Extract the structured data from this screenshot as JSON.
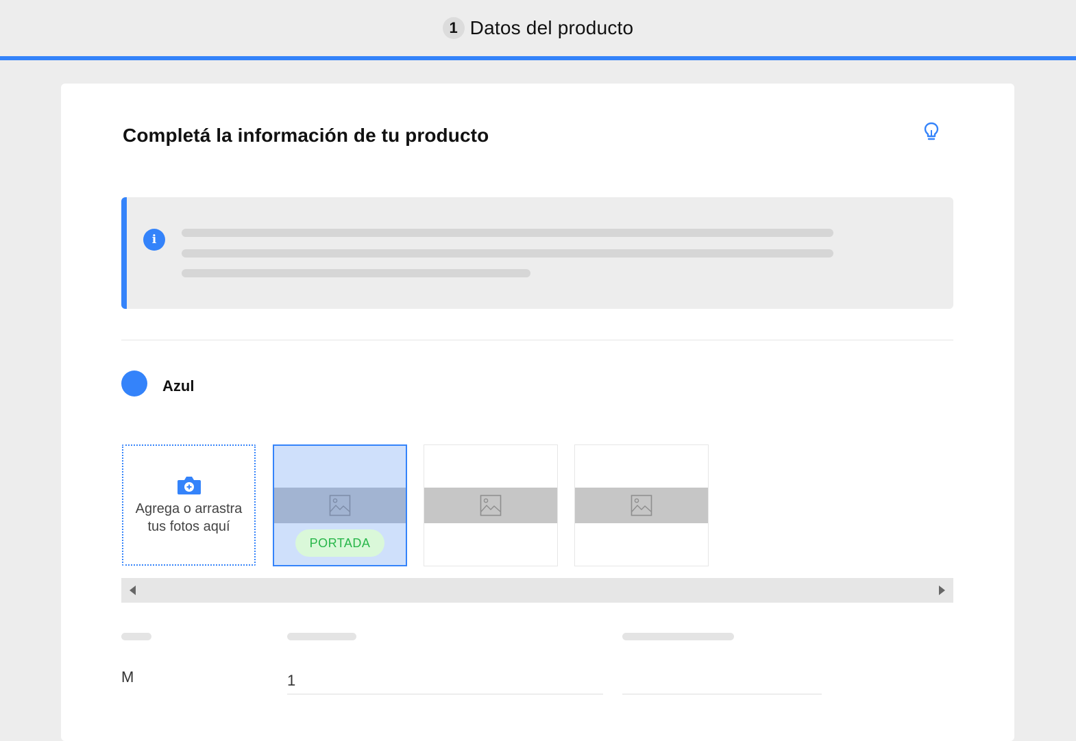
{
  "header": {
    "step_number": "1",
    "step_title": "Datos del producto",
    "accent_color": "#3483fa"
  },
  "card": {
    "title": "Completá la información de tu producto",
    "tip_icon": "lightbulb-icon"
  },
  "info_box": {
    "icon": "info-icon",
    "icon_glyph": "i"
  },
  "variant": {
    "color_name": "Azul",
    "color_hex": "#3483fa"
  },
  "photos": {
    "upload_label": "Agrega o arrastra tus fotos aquí",
    "upload_icon": "camera-add-icon",
    "items": [
      {
        "selected": true,
        "badge": "PORTADA"
      },
      {
        "selected": false
      },
      {
        "selected": false
      }
    ]
  },
  "stock_row": {
    "size": "M",
    "quantity": "1",
    "extra": ""
  }
}
